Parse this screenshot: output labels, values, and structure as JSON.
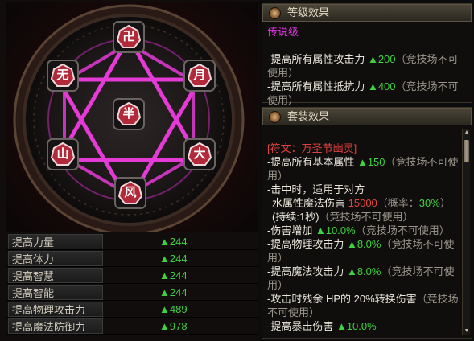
{
  "runes": {
    "top": "卍",
    "upper_left": "无",
    "upper_right": "月",
    "center": "半",
    "lower_left": "山",
    "lower_right": "大",
    "bottom": "风"
  },
  "stats": [
    {
      "label": "提高力量",
      "value": "▲244"
    },
    {
      "label": "提高体力",
      "value": "▲244"
    },
    {
      "label": "提高智慧",
      "value": "▲244"
    },
    {
      "label": "提高智能",
      "value": "▲244"
    },
    {
      "label": "提高物理攻击力",
      "value": "▲489"
    },
    {
      "label": "提高魔法防御力",
      "value": "▲978"
    }
  ],
  "grade_panel": {
    "title": "等级效果",
    "grade": "传说级",
    "lines": [
      {
        "text": "-提高所有属性攻击力 ",
        "value": "▲200",
        "note": "（竞技场不可使用）"
      },
      {
        "text": "-提高所有属性抵抗力 ",
        "value": "▲400",
        "note": "（竞技场不可使用）"
      }
    ]
  },
  "set_panel": {
    "title": "套装效果",
    "set_name": "[符文：万圣节幽灵]",
    "line1_text": "-提高所有基本属性 ",
    "line1_value": "▲150",
    "line1_note": "（竞技场不可使用）",
    "line2_text": "-击中时，适用于对方",
    "line3_text": "水属性魔法伤害 ",
    "line3_value": "15000",
    "line3_mid": "（概率：",
    "line3_pct": "30%",
    "line3_close": "）",
    "line3_dur": "(持续:1秒)",
    "line3_note": "（竞技场不可使用）",
    "line4_text": "-伤害增加 ",
    "line4_value": "▲10.0%",
    "line4_note": "（竞技场不可使用）",
    "line5_text": "-提高物理攻击力 ",
    "line5_value": "▲8.0%",
    "line5_note": "（竞技场不可使用）",
    "line6_text": "-提高魔法攻击力 ",
    "line6_value": "▲8.0%",
    "line6_note": "（竞技场不可使用）",
    "line7_text": "-攻击时残余 HP的 20%转换伤害",
    "line7_note": "（竞技场不可使用）",
    "line8_text": "-提高暴击伤害 ",
    "line8_value": "▲10.0%"
  },
  "colors": {
    "legend": "#e02fe0",
    "positive": "#3fd13f",
    "set_name": "#e04141",
    "hexagram": "#e43ad6"
  }
}
